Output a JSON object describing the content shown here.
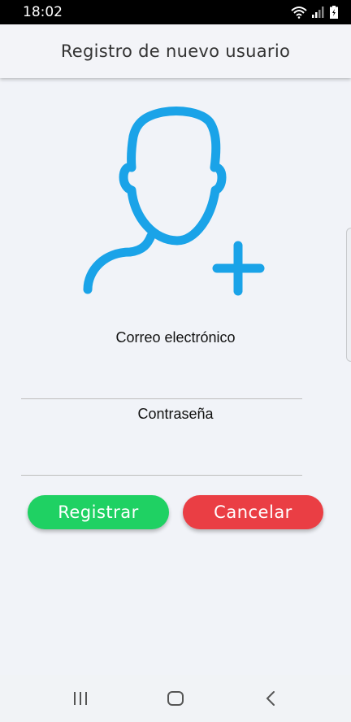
{
  "status_bar": {
    "time": "18:02",
    "icons": [
      "wifi-icon",
      "signal-icon",
      "battery-icon"
    ]
  },
  "header": {
    "title": "Registro de nuevo usuario"
  },
  "avatar": {
    "icon": "add-user-icon",
    "color": "#1aa3e8"
  },
  "form": {
    "email_label": "Correo electrónico",
    "email_value": "",
    "password_label": "Contraseña",
    "password_value": ""
  },
  "buttons": {
    "register_label": "Registrar",
    "register_color": "#1fd163",
    "cancel_label": "Cancelar",
    "cancel_color": "#ea3e44"
  },
  "nav_bar": {
    "icons": [
      "recent-apps-icon",
      "home-icon",
      "back-icon"
    ]
  }
}
